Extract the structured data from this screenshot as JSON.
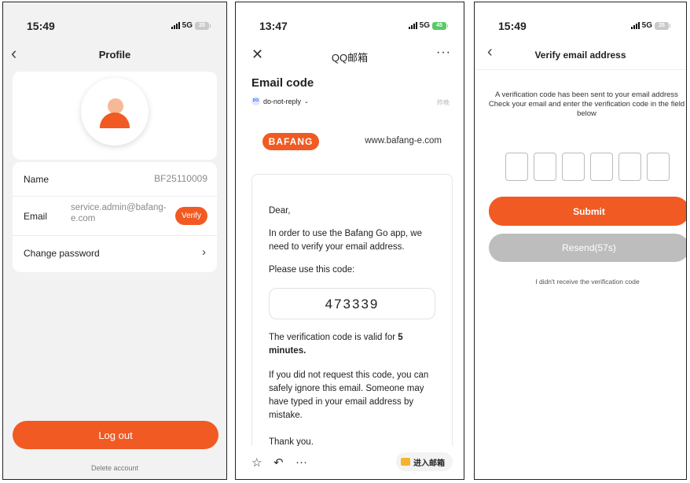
{
  "colors": {
    "accent": "#f15a22",
    "disabled": "#bdbdbd"
  },
  "profile_screen": {
    "status": {
      "time": "15:49",
      "network": "5G",
      "battery": "25"
    },
    "nav": {
      "title": "Profile",
      "back_icon": "chevron-left-icon"
    },
    "name": {
      "label": "Name",
      "value": "BF25110009"
    },
    "email": {
      "label": "Email",
      "value": "service.admin@bafang-e.com",
      "verify_label": "Verify"
    },
    "change_password": {
      "label": "Change password"
    },
    "logout_label": "Log out",
    "delete_label": "Delete account"
  },
  "mail_screen": {
    "status": {
      "time": "13:47",
      "network": "5G",
      "battery": "45"
    },
    "nav": {
      "title": "QQ邮箱"
    },
    "subject": "Email code",
    "sender": {
      "avatar": "DO",
      "name": "do-not-reply",
      "extra": "昨晚"
    },
    "brand": "BAFANG",
    "site": "www.bafang-e.com",
    "body": {
      "greeting": "Dear,",
      "p1": "In order to use the Bafang Go app, we need to verify your email address.",
      "p2": "Please use this code:",
      "code": "473339",
      "p3_prefix": "The verification code is valid for ",
      "p3_bold": "5 minutes.",
      "p4": "If you did not request this code, you can safely ignore this email. Someone may have typed in your email address by mistake.",
      "p5": "Thank you."
    },
    "enter_label": "进入邮箱"
  },
  "verify_screen": {
    "status": {
      "time": "15:49",
      "network": "5G",
      "battery": "25"
    },
    "nav": {
      "title": "Verify email address"
    },
    "instruction_1": "A verification code has been sent to your email address",
    "instruction_2": "Check your email and enter the verification code in the field below",
    "submit_label": "Submit",
    "resend_label": "Resend(57s)",
    "no_receive": "I didn't receive the verification code"
  }
}
